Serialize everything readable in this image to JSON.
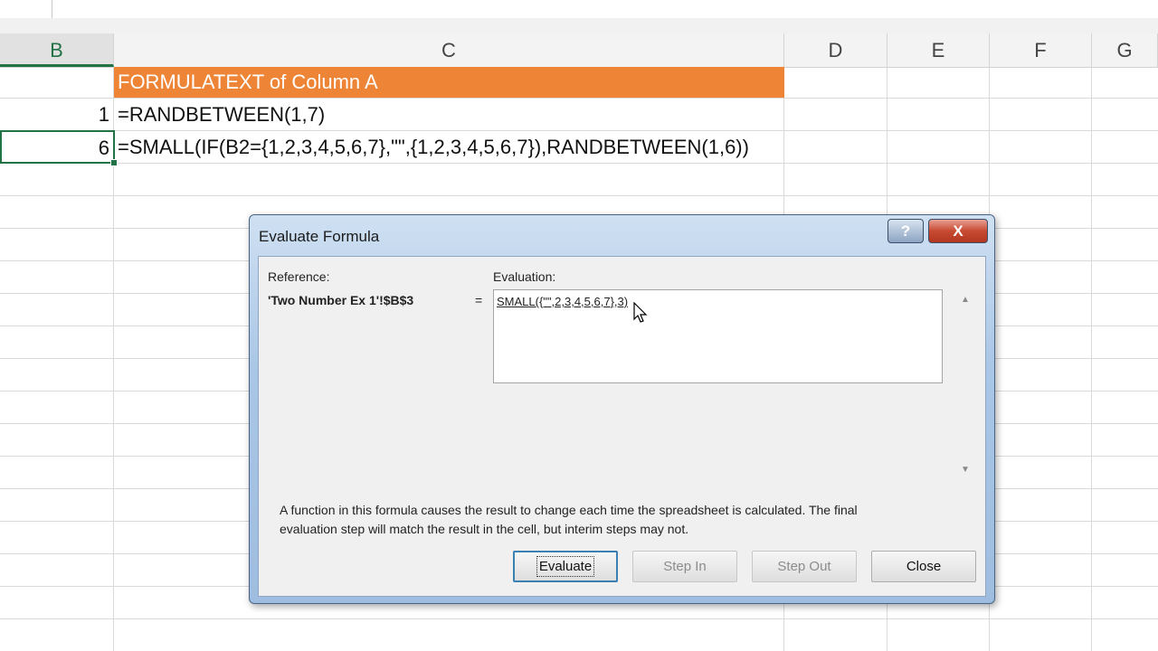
{
  "columns": [
    "B",
    "C",
    "D",
    "E",
    "F",
    "G"
  ],
  "cells": {
    "c1": "FORMULATEXT of Column A",
    "b2": "1",
    "c2": "=RANDBETWEEN(1,7)",
    "b3": "6",
    "c3": "=SMALL(IF(B2={1,2,3,4,5,6,7},\"\",{1,2,3,4,5,6,7}),RANDBETWEEN(1,6))"
  },
  "colors": {
    "header_fill": "#ee8435",
    "selection": "#217346"
  },
  "dialog": {
    "title": "Evaluate Formula",
    "help_label": "?",
    "close_x_label": "X",
    "reference_label": "Reference:",
    "reference_value": "'Two Number Ex 1'!$B$3",
    "equals": "=",
    "evaluation_label": "Evaluation:",
    "evaluation_value": "SMALL({\"\",2,3,4,5,6,7},3)",
    "note": "A function in this formula causes the result to change each time the spreadsheet is calculated.  The final evaluation step will match the result in the cell, but interim steps may not.",
    "buttons": {
      "evaluate": "Evaluate",
      "step_in": "Step In",
      "step_out": "Step Out",
      "close": "Close"
    }
  }
}
